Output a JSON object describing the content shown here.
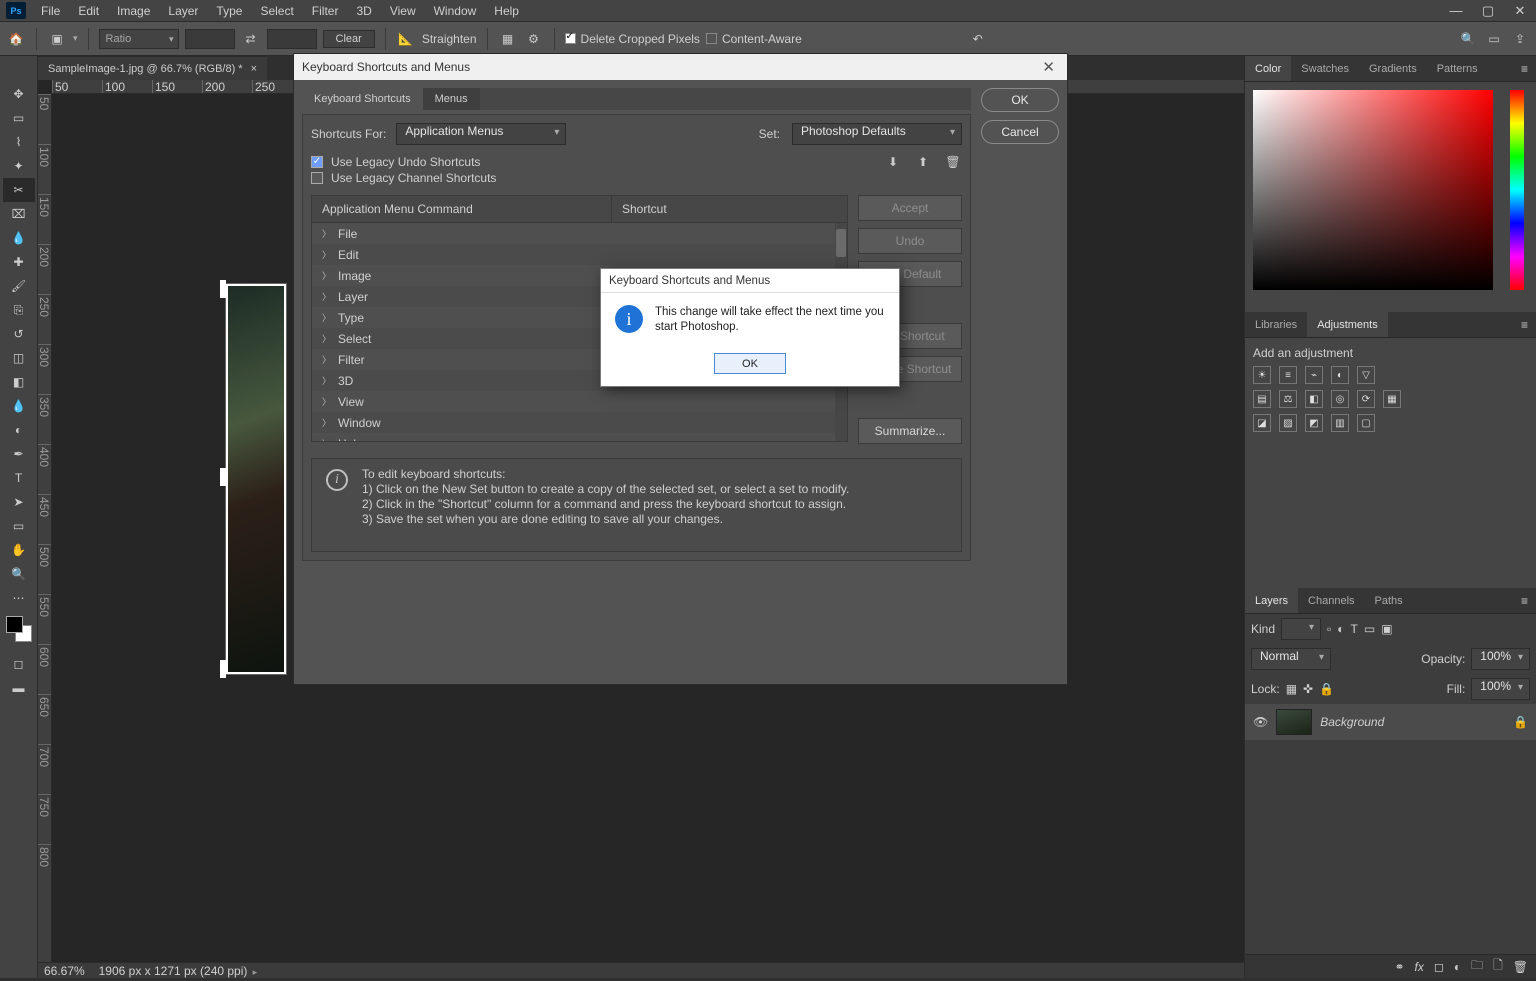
{
  "menubar": {
    "items": [
      "File",
      "Edit",
      "Image",
      "Layer",
      "Type",
      "Select",
      "Filter",
      "3D",
      "View",
      "Window",
      "Help"
    ]
  },
  "optbar": {
    "ratio_label": "Ratio",
    "clear": "Clear",
    "straighten": "Straighten",
    "delete_cropped": "Delete Cropped Pixels",
    "content_aware": "Content-Aware"
  },
  "doc": {
    "tab": "SampleImage-1.jpg @ 66.7% (RGB/8) *"
  },
  "status": {
    "zoom": "66.67%",
    "info": "1906 px x 1271 px (240 ppi)"
  },
  "rulerH": [
    "50",
    "100",
    "150",
    "200",
    "250"
  ],
  "rulerV": [
    "50",
    "100",
    "150",
    "200",
    "250",
    "300",
    "350",
    "400",
    "450",
    "500",
    "550",
    "600",
    "650",
    "700",
    "750",
    "800"
  ],
  "rightTabs": {
    "color": "Color",
    "swatches": "Swatches",
    "gradients": "Gradients",
    "patterns": "Patterns",
    "libraries": "Libraries",
    "adjustments": "Adjustments",
    "layers": "Layers",
    "channels": "Channels",
    "paths": "Paths"
  },
  "adj": {
    "hint": "Add an adjustment"
  },
  "layers": {
    "kind": "Kind",
    "opacity_l": "Opacity:",
    "opacity_v": "100%",
    "mode": "Normal",
    "lock": "Lock:",
    "fill_l": "Fill:",
    "fill_v": "100%",
    "bg": "Background"
  },
  "ksm": {
    "title": "Keyboard Shortcuts and Menus",
    "tab_ks": "Keyboard Shortcuts",
    "tab_mn": "Menus",
    "shortcuts_for": "Shortcuts For:",
    "app_menus": "Application Menus",
    "set": "Set:",
    "set_val": "Photoshop Defaults",
    "legacy_undo": "Use Legacy Undo Shortcuts",
    "legacy_chan": "Use Legacy Channel Shortcuts",
    "col_cmd": "Application Menu Command",
    "col_sc": "Shortcut",
    "menus": [
      "File",
      "Edit",
      "Image",
      "Layer",
      "Type",
      "Select",
      "Filter",
      "3D",
      "View",
      "Window",
      "Help"
    ],
    "btn_accept": "Accept",
    "btn_undo": "Undo",
    "btn_default": "Use Default",
    "btn_add": "Add Shortcut",
    "btn_del": "Delete Shortcut",
    "btn_sum": "Summarize...",
    "ok": "OK",
    "cancel": "Cancel",
    "info_h": "To edit keyboard shortcuts:",
    "info_1": "1) Click on the New Set button to create a copy of the selected set, or select a set to modify.",
    "info_2": "2) Click in the \"Shortcut\" column for a command and press the keyboard shortcut to assign.",
    "info_3": "3) Save the set when you are done editing to save all your changes."
  },
  "alert": {
    "title": "Keyboard Shortcuts and Menus",
    "msg": "This change will take effect the next time you start Photoshop.",
    "ok": "OK"
  },
  "tooltips": {
    "home": "⌂",
    "crop": "✂"
  }
}
